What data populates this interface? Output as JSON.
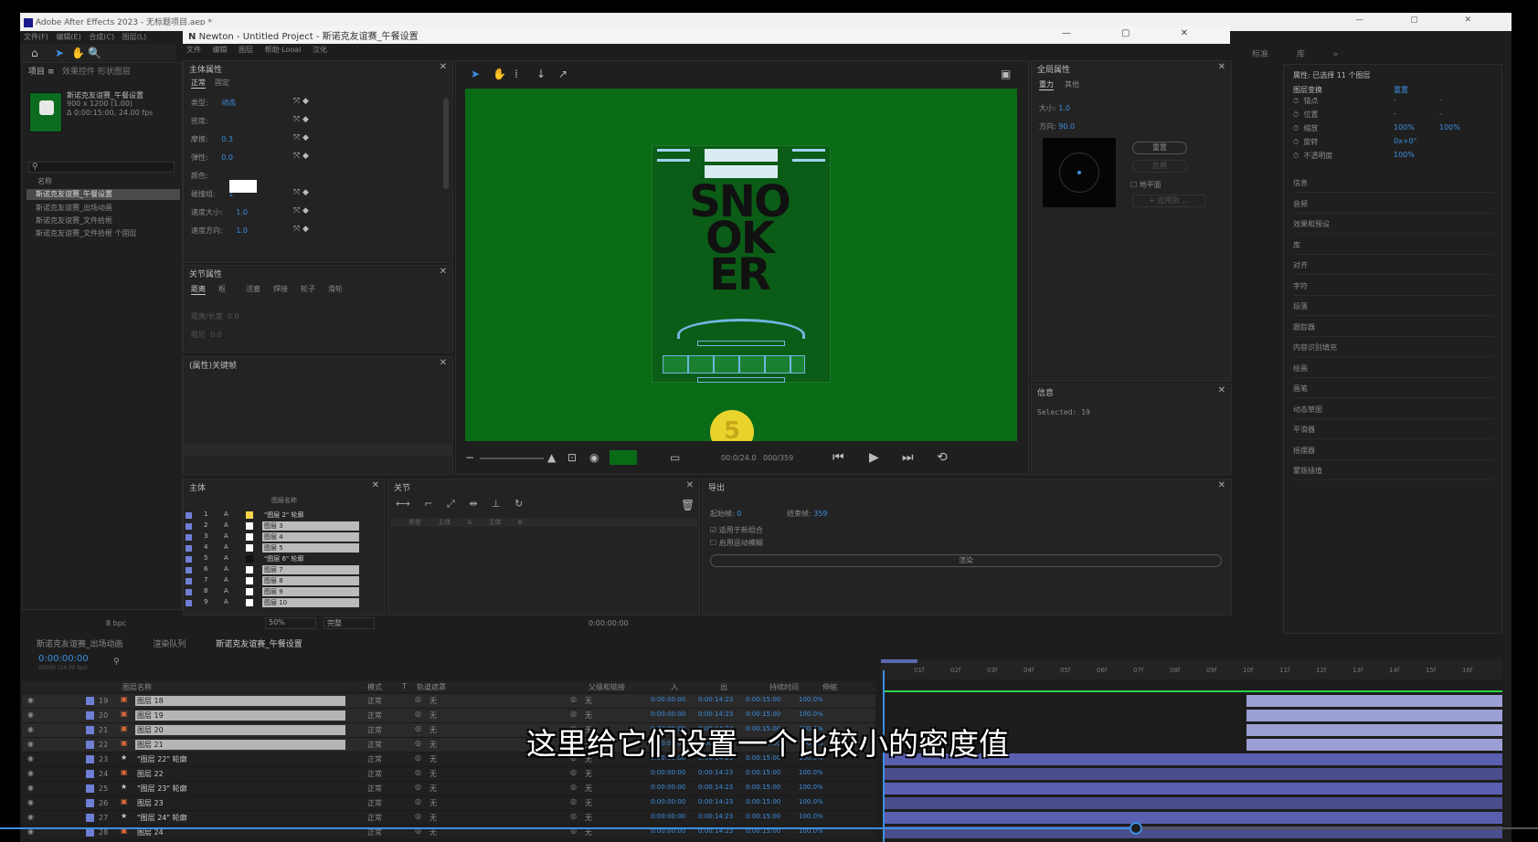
{
  "ae": {
    "title": "Adobe After Effects 2023 - 无标题项目.aep *",
    "menus": [
      "文件(F)",
      "编辑(E)",
      "合成(C)",
      "图层(L)"
    ],
    "right_tabs": [
      "标准",
      "库"
    ]
  },
  "newton": {
    "title": "Newton - Untitled Project - 斯诺克友谊赛_午餐设置",
    "menus": [
      "文件",
      "编辑",
      "图层",
      "帮助·Looai 汉化"
    ],
    "logo": "N"
  },
  "project": {
    "tab": "项目",
    "effects_tab": "效果控件 形状图层",
    "comp_name": "斯诺克友谊赛_午餐设置",
    "comp_info": "900 x 1200 (1.00)",
    "comp_dur": "Δ 0:00:15:00, 24.00 fps",
    "col_name": "名称",
    "items": [
      "斯诺克友谊赛_午餐设置",
      "斯诺克友谊赛_出场动画",
      "斯诺克友谊赛_文件拾框",
      "斯诺克友谊赛_文件拾框 个固层"
    ]
  },
  "body_props": {
    "title": "主体属性",
    "tabs": [
      "正常",
      "固定"
    ],
    "rows": [
      {
        "label": "类型:",
        "value": "动态"
      },
      {
        "label": "密度:",
        "value": ""
      },
      {
        "label": "摩擦:",
        "value": "0.3"
      },
      {
        "label": "弹性:",
        "value": "0.0"
      },
      {
        "label": "颜色:",
        "value": ""
      },
      {
        "label": "碰撞组:",
        "value": "1"
      },
      {
        "label": "速度大小:",
        "value": "1.0"
      },
      {
        "label": "速度方向:",
        "value": "1.0"
      }
    ]
  },
  "joint_props": {
    "title": "关节属性",
    "tabs": [
      "距离",
      "枢",
      "活塞",
      "焊接",
      "轮子",
      "滑轮"
    ],
    "rows": [
      {
        "label": "距离/长度",
        "value": "0.0"
      },
      {
        "label": "阻尼",
        "value": "0.0"
      }
    ]
  },
  "attr_link": {
    "title": "(属性)关键帧"
  },
  "viewer": {
    "time": "00:0/24.0",
    "frames": "000/359",
    "zoom": "50%",
    "quality": "完整",
    "brand_top": [
      "SNO",
      "OK",
      "ER"
    ],
    "ball": "5"
  },
  "world_props": {
    "title": "全局属性",
    "tabs": [
      "重力",
      "其他"
    ],
    "size_label": "大小:",
    "size": "1.0",
    "dir_label": "方向:",
    "dir": "90.0",
    "btn_reset": "重置",
    "checkbox_label": "地平面",
    "btn_add": "应用",
    "btn_apply": "+ 应用到 ..."
  },
  "info": {
    "title": "信息",
    "selected": "Selected: 19"
  },
  "bodies": {
    "title": "主体",
    "col": "图层名称",
    "rows": [
      {
        "n": "1",
        "name": "\"图层 2\" 轮廓"
      },
      {
        "n": "2",
        "name": "图层 3"
      },
      {
        "n": "3",
        "name": "图层 4"
      },
      {
        "n": "4",
        "name": "图层 5"
      },
      {
        "n": "5",
        "name": "\"图层 6\" 轮廓"
      },
      {
        "n": "6",
        "name": "图层 7"
      },
      {
        "n": "7",
        "name": "图层 8"
      },
      {
        "n": "8",
        "name": "图层 9"
      },
      {
        "n": "9",
        "name": "图层 10"
      }
    ]
  },
  "joints": {
    "title": "关节",
    "cols": [
      "类型",
      "主体 A",
      "主体 B"
    ]
  },
  "export": {
    "title": "导出",
    "start_label": "起始帧:",
    "start": "0",
    "end_label": "结束帧:",
    "end": "359",
    "opt1": "适用于新组合",
    "opt2": "启用运动模糊",
    "render": "渲染"
  },
  "props": {
    "title": "属性: 已选择 11 个图层",
    "group": "图层变换",
    "reset": "重置",
    "rows": [
      {
        "label": "锚点",
        "v1": "-",
        "v2": "-"
      },
      {
        "label": "位置",
        "v1": "-",
        "v2": "-"
      },
      {
        "label": "缩放",
        "v1": "100%",
        "v2": "100%"
      },
      {
        "label": "旋转",
        "v1": "0x+0°",
        "v2": ""
      },
      {
        "label": "不透明度",
        "v1": "100%",
        "v2": ""
      }
    ],
    "list": [
      "信息",
      "音频",
      "效果和预设",
      "库",
      "对齐",
      "字符",
      "段落",
      "跟踪器",
      "内容识别填充",
      "绘画",
      "画笔",
      "动态草图",
      "平滑器",
      "摇摆器",
      "蒙版插值"
    ]
  },
  "footer": {
    "bpc": "8 bpc",
    "zoom": "50%",
    "quality": "完整",
    "timecode": "0:00:00:00"
  },
  "timeline": {
    "tabs": [
      "斯诺克友谊赛_出场动画",
      "渲染队列",
      "斯诺克友谊赛_午餐设置"
    ],
    "timecode": "0:00:00:00",
    "fps": "00000 (24.00 fps)",
    "cols": [
      "图层名称",
      "模式",
      "T",
      "轨道遮罩",
      "父级和链接",
      "入",
      "出",
      "持续时间",
      "伸缩"
    ],
    "ruler": [
      "01f",
      "02f",
      "03f",
      "04f",
      "05f",
      "06f",
      "07f",
      "08f",
      "09f",
      "10f",
      "11f",
      "12f",
      "13f",
      "14f",
      "15f",
      "16f"
    ],
    "layers": [
      {
        "n": "19",
        "name": "图层 18",
        "mode": "正常",
        "matte": "无",
        "parent": "无",
        "in": "0:00:00:00",
        "out": "0:00:14:23",
        "dur": "0:00:15:00",
        "str": "100.0%",
        "star": false
      },
      {
        "n": "20",
        "name": "图层 19",
        "mode": "正常",
        "matte": "无",
        "parent": "无",
        "in": "0:00:00:00",
        "out": "0:00:14:23",
        "dur": "0:00:15:00",
        "str": "100.0%",
        "star": false
      },
      {
        "n": "21",
        "name": "图层 20",
        "mode": "正常",
        "matte": "无",
        "parent": "无",
        "in": "0:00:00:00",
        "out": "0:00:14:23",
        "dur": "0:00:15:00",
        "str": "100.0%",
        "star": false
      },
      {
        "n": "22",
        "name": "图层 21",
        "mode": "正常",
        "matte": "无",
        "parent": "无",
        "in": "0:00:00:00",
        "out": "0:00:14:23",
        "dur": "0:00:15:00",
        "str": "100.0%",
        "star": false
      },
      {
        "n": "23",
        "name": "\"图层 22\" 轮廓",
        "mode": "正常",
        "matte": "无",
        "parent": "无",
        "in": "0:00:00:00",
        "out": "0:00:14:23",
        "dur": "0:00:15:00",
        "str": "100.0%",
        "star": true
      },
      {
        "n": "24",
        "name": "图层 22",
        "mode": "正常",
        "matte": "无",
        "parent": "无",
        "in": "0:00:00:00",
        "out": "0:00:14:23",
        "dur": "0:00:15:00",
        "str": "100.0%",
        "star": false
      },
      {
        "n": "25",
        "name": "\"图层 23\" 轮廓",
        "mode": "正常",
        "matte": "无",
        "parent": "无",
        "in": "0:00:00:00",
        "out": "0:00:14:23",
        "dur": "0:00:15:00",
        "str": "100.0%",
        "star": true
      },
      {
        "n": "26",
        "name": "图层 23",
        "mode": "正常",
        "matte": "无",
        "parent": "无",
        "in": "0:00:00:00",
        "out": "0:00:14:23",
        "dur": "0:00:15:00",
        "str": "100.0%",
        "star": false
      },
      {
        "n": "27",
        "name": "\"图层 24\" 轮廓",
        "mode": "正常",
        "matte": "无",
        "parent": "无",
        "in": "0:00:00:00",
        "out": "0:00:14:23",
        "dur": "0:00:15:00",
        "str": "100.0%",
        "star": true
      },
      {
        "n": "28",
        "name": "图层 24",
        "mode": "正常",
        "matte": "无",
        "parent": "无",
        "in": "0:00:00:00",
        "out": "0:00:14:23",
        "dur": "0:00:15:00",
        "str": "100.0%",
        "star": false
      }
    ]
  },
  "subtitle": "这里给它们设置一个比较小的密度值"
}
